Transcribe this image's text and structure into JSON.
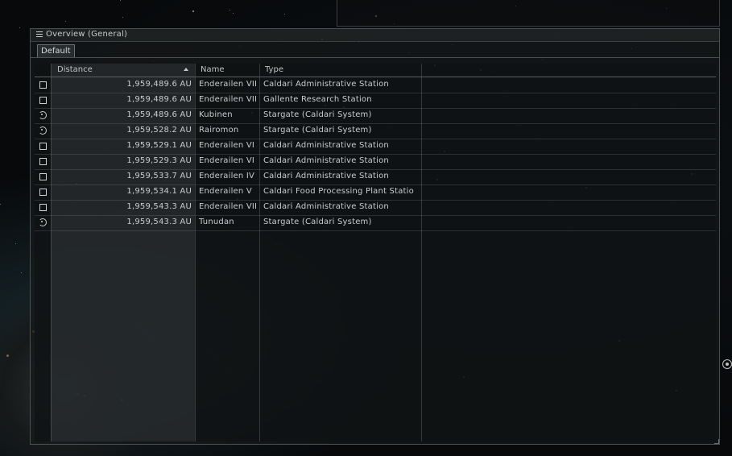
{
  "overview": {
    "title": "Overview (General)",
    "tab": "Default",
    "columns": {
      "distance": "Distance",
      "name": "Name",
      "type": "Type"
    },
    "rows": [
      {
        "icon": "station-square-icon",
        "distance": "1,959,489.6 AU",
        "name": "Enderailen VII",
        "type": "Caldari Administrative Station"
      },
      {
        "icon": "station-square-icon",
        "distance": "1,959,489.6 AU",
        "name": "Enderailen VII",
        "type": "Gallente Research Station"
      },
      {
        "icon": "stargate-icon",
        "distance": "1,959,489.6 AU",
        "name": "Kubinen",
        "type": "Stargate (Caldari System)"
      },
      {
        "icon": "stargate-icon",
        "distance": "1,959,528.2 AU",
        "name": "Rairomon",
        "type": "Stargate (Caldari System)"
      },
      {
        "icon": "station-square-icon",
        "distance": "1,959,529.1 AU",
        "name": "Enderailen VI",
        "type": "Caldari Administrative Station"
      },
      {
        "icon": "station-square-icon",
        "distance": "1,959,529.3 AU",
        "name": "Enderailen VI",
        "type": "Caldari Administrative Station"
      },
      {
        "icon": "station-square-icon",
        "distance": "1,959,533.7 AU",
        "name": "Enderailen IV",
        "type": "Caldari Administrative Station"
      },
      {
        "icon": "station-square-icon",
        "distance": "1,959,534.1 AU",
        "name": "Enderailen V",
        "type": "Caldari Food Processing Plant Statio"
      },
      {
        "icon": "station-square-icon",
        "distance": "1,959,543.3 AU",
        "name": "Enderailen VII",
        "type": "Caldari Administrative Station"
      },
      {
        "icon": "stargate-icon",
        "distance": "1,959,543.3 AU",
        "name": "Tunudan",
        "type": "Stargate (Caldari System)"
      }
    ]
  }
}
